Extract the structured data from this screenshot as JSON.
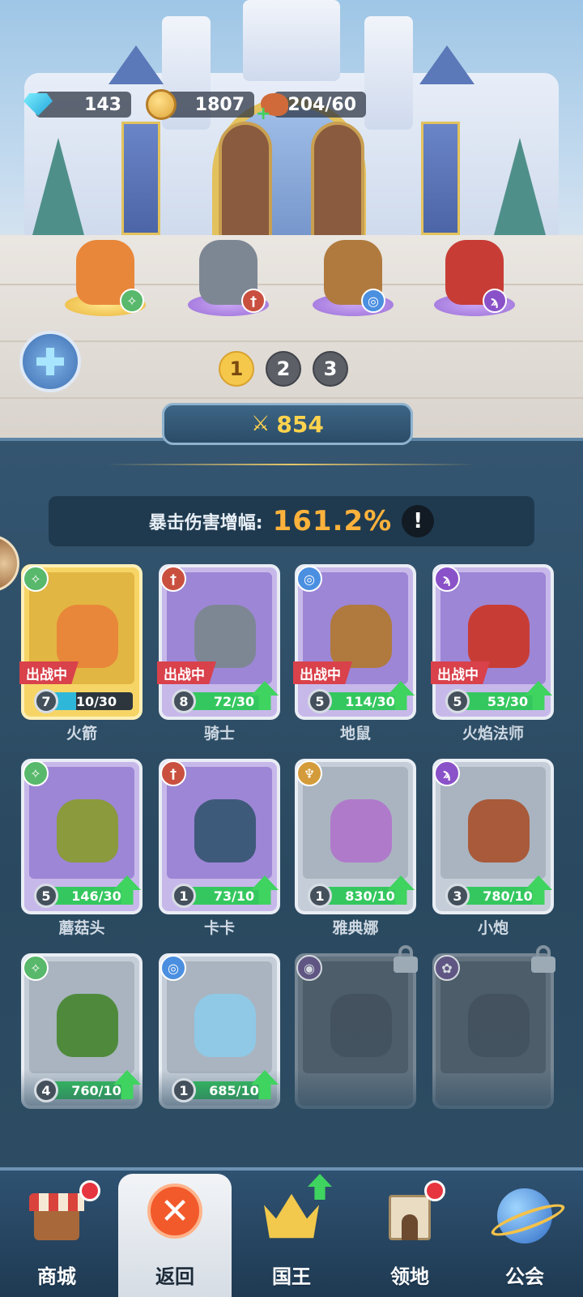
{
  "resources": {
    "gems": "143",
    "coins": "1807",
    "stamina": "204/60",
    "icons": [
      "gem-icon",
      "gold-coin-icon",
      "meat-stamina-icon"
    ]
  },
  "team_pages": [
    "1",
    "2",
    "3"
  ],
  "active_team_page": "1",
  "power": "854",
  "stat": {
    "label": "暴击伤害增幅:",
    "value": "161.2%",
    "info": "!"
  },
  "deployed_label": "出战中",
  "heroes": [
    {
      "name": "火箭",
      "level": "7",
      "fragments": "10/30",
      "fill": 0.33,
      "deployed": true,
      "upgradable": false,
      "locked": false,
      "class_icon": "bow-class-icon",
      "card_color": "gold"
    },
    {
      "name": "骑士",
      "level": "8",
      "fragments": "72/30",
      "fill": 1,
      "deployed": true,
      "upgradable": true,
      "locked": false,
      "class_icon": "sword-class-icon",
      "card_color": "purple"
    },
    {
      "name": "地鼠",
      "level": "5",
      "fragments": "114/30",
      "fill": 1,
      "deployed": true,
      "upgradable": true,
      "locked": false,
      "class_icon": "spiral-class-icon",
      "card_color": "purple"
    },
    {
      "name": "火焰法师",
      "level": "5",
      "fragments": "53/30",
      "fill": 1,
      "deployed": true,
      "upgradable": true,
      "locked": false,
      "class_icon": "staff-class-icon",
      "card_color": "purple"
    },
    {
      "name": "蘑菇头",
      "level": "5",
      "fragments": "146/30",
      "fill": 1,
      "deployed": false,
      "upgradable": true,
      "locked": false,
      "class_icon": "bow-class-icon",
      "card_color": "purple"
    },
    {
      "name": "卡卡",
      "level": "1",
      "fragments": "73/10",
      "fill": 1,
      "deployed": false,
      "upgradable": true,
      "locked": false,
      "class_icon": "sword-class-icon",
      "card_color": "purple"
    },
    {
      "name": "雅典娜",
      "level": "1",
      "fragments": "830/10",
      "fill": 1,
      "deployed": false,
      "upgradable": true,
      "locked": false,
      "class_icon": "wings-class-icon",
      "card_color": "grey"
    },
    {
      "name": "小炮",
      "level": "3",
      "fragments": "780/10",
      "fill": 1,
      "deployed": false,
      "upgradable": true,
      "locked": false,
      "class_icon": "staff-class-icon",
      "card_color": "grey"
    },
    {
      "name": "",
      "level": "4",
      "fragments": "760/10",
      "fill": 1,
      "deployed": false,
      "upgradable": true,
      "locked": false,
      "class_icon": "bow-class-icon",
      "card_color": "grey"
    },
    {
      "name": "",
      "level": "1",
      "fragments": "685/10",
      "fill": 1,
      "deployed": false,
      "upgradable": true,
      "locked": false,
      "class_icon": "spiral-class-icon",
      "card_color": "grey"
    },
    {
      "name": "",
      "level": "",
      "fragments": "",
      "fill": 0,
      "deployed": false,
      "upgradable": false,
      "locked": true,
      "class_icon": "eye-class-icon",
      "card_color": "locked"
    },
    {
      "name": "",
      "level": "",
      "fragments": "",
      "fill": 0,
      "deployed": false,
      "upgradable": false,
      "locked": true,
      "class_icon": "paw-class-icon",
      "card_color": "locked"
    }
  ],
  "nav": [
    {
      "label": "商城",
      "icon": "shop-icon",
      "badge": "red-dot",
      "active": false
    },
    {
      "label": "返回",
      "icon": "close-icon",
      "badge": "",
      "active": true
    },
    {
      "label": "国王",
      "icon": "crown-icon",
      "badge": "green-up",
      "active": false
    },
    {
      "label": "领地",
      "icon": "fortress-icon",
      "badge": "red-dot",
      "active": false
    },
    {
      "label": "公会",
      "icon": "planet-icon",
      "badge": "",
      "active": false
    }
  ],
  "colors": {
    "panel": "#2d4c63",
    "stat_value": "#ffb23b",
    "power": "#ffd34d",
    "deployed_tag": "#d9414b",
    "upgrade_arrow": "#3fd35f",
    "class_bow": "#58b86b",
    "class_sword": "#c9503f",
    "class_spiral": "#4b8fe0",
    "class_staff": "#8a52c9",
    "class_wings": "#d49b3a"
  }
}
